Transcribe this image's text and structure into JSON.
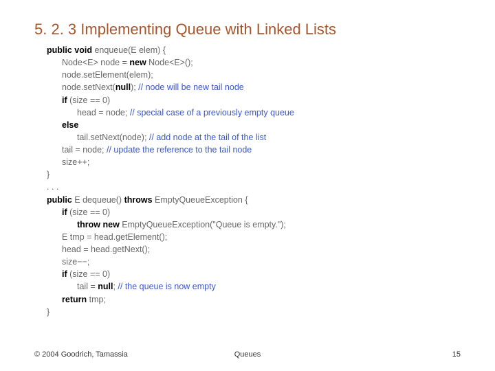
{
  "title": "5. 2. 3 Implementing Queue with Linked Lists",
  "code": {
    "l01a": "public void",
    "l01b": " enqueue(E elem) {",
    "l02": "Node<E> node = ",
    "l02kw": "new",
    "l02b": " Node<E>();",
    "l03": "node.setElement(elem);",
    "l04a": "node.setNext(",
    "l04kw": "null",
    "l04b": "); ",
    "l04c": "// node will be new tail node",
    "l05a": "if",
    "l05b": " (size == 0)",
    "l06a": "head = node; ",
    "l06c": "// special case of a previously empty queue",
    "l07": "else",
    "l08a": "tail.setNext(node); ",
    "l08c": "// add node at the tail of the list",
    "l09a": "tail = node; ",
    "l09c": "// update the reference to the tail node",
    "l10": "size++;",
    "l11": "}",
    "dots": ". . .",
    "d01a": "public",
    "d01b": " E dequeue() ",
    "d01c": "throws",
    "d01d": " EmptyQueueException {",
    "d02a": "if",
    "d02b": " (size == 0)",
    "d03a": "throw new",
    "d03b": " EmptyQueueException(\"Queue is empty.\");",
    "d04": "E tmp = head.getElement();",
    "d05": "head = head.getNext();",
    "d06": "size−−;",
    "d07a": "if",
    "d07b": " (size == 0)",
    "d08a": "tail = ",
    "d08kw": "null",
    "d08b": "; ",
    "d08c": "// the queue is now empty",
    "d09a": "return",
    "d09b": " tmp;",
    "d10": "}"
  },
  "footer": {
    "left": "© 2004 Goodrich, Tamassia",
    "center": "Queues",
    "right": "15"
  }
}
